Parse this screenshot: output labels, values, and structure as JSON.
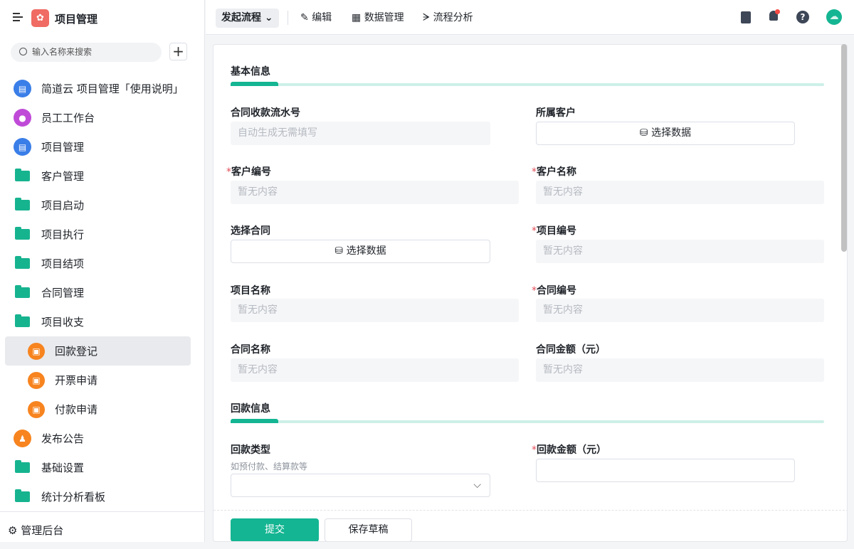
{
  "app": {
    "title": "项目管理"
  },
  "search": {
    "placeholder": "输入名称来搜索"
  },
  "sidebar": {
    "items": [
      {
        "label": "简道云 项目管理「使用说明」",
        "icon": "document-icon",
        "color": "#3a7ee8"
      },
      {
        "label": "员工工作台",
        "icon": "user-icon",
        "color": "#c04ad8"
      },
      {
        "label": "项目管理",
        "icon": "document-icon",
        "color": "#3a7ee8"
      },
      {
        "label": "客户管理",
        "icon": "folder-icon"
      },
      {
        "label": "项目启动",
        "icon": "folder-icon"
      },
      {
        "label": "项目执行",
        "icon": "folder-icon"
      },
      {
        "label": "项目结项",
        "icon": "folder-icon"
      },
      {
        "label": "合同管理",
        "icon": "folder-icon"
      },
      {
        "label": "项目收支",
        "icon": "folder-open-icon"
      },
      {
        "label": "回款登记",
        "icon": "form-icon",
        "color": "#f7841f"
      },
      {
        "label": "开票申请",
        "icon": "form-icon",
        "color": "#f7841f"
      },
      {
        "label": "付款申请",
        "icon": "form-icon",
        "color": "#f7841f"
      },
      {
        "label": "发布公告",
        "icon": "stamp-icon",
        "color": "#f7841f"
      },
      {
        "label": "基础设置",
        "icon": "folder-icon"
      },
      {
        "label": "统计分析看板",
        "icon": "folder-icon"
      }
    ],
    "admin": "管理后台"
  },
  "topbar": {
    "flow": "发起流程",
    "edit": "编辑",
    "data": "数据管理",
    "analysis": "流程分析"
  },
  "form": {
    "sec1": "基本信息",
    "sec2": "回款信息",
    "serial_label": "合同收款流水号",
    "serial_value": "自动生成无需填写",
    "customer_label": "所属客户",
    "select_data": "选择数据",
    "cust_no_label": "客户编号",
    "cust_name_label": "客户名称",
    "contract_select_label": "选择合同",
    "proj_no_label": "项目编号",
    "proj_name_label": "项目名称",
    "contract_no_label": "合同编号",
    "contract_name_label": "合同名称",
    "amount_label": "合同金额（元）",
    "empty": "暂无内容",
    "type_label": "回款类型",
    "type_hint": "如预付款、结算款等",
    "pay_amount_label": "回款金额（元）",
    "submit": "提交",
    "draft": "保存草稿"
  }
}
